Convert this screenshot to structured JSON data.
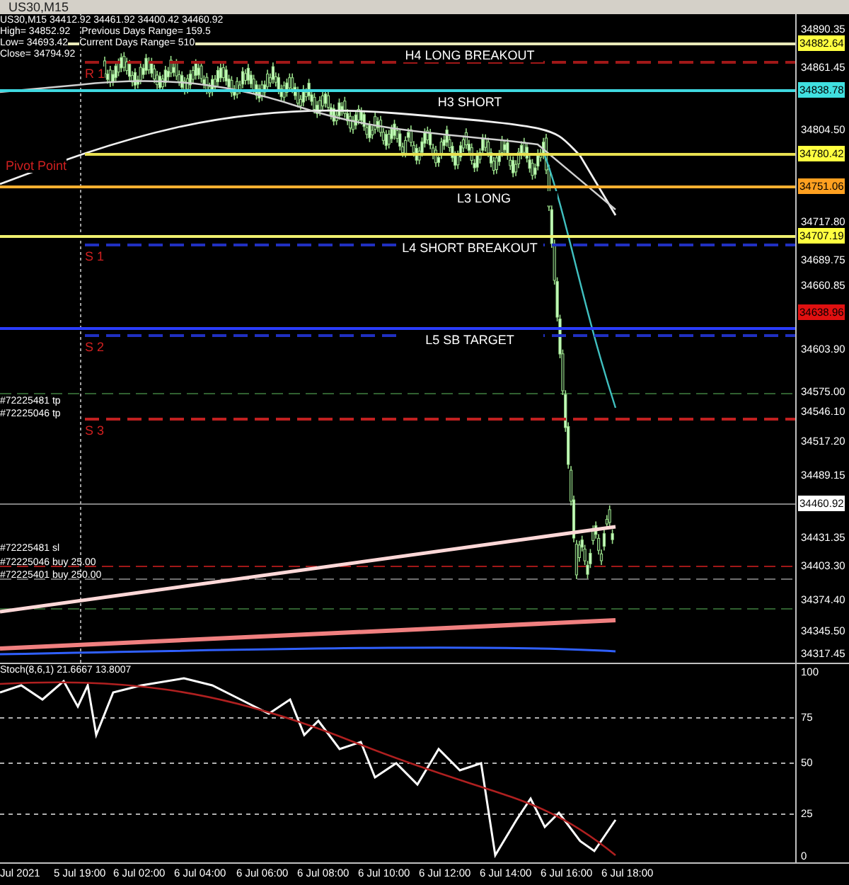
{
  "window": {
    "title": "US30,M15"
  },
  "chart": {
    "info_lines": [
      [
        "US30,M15  34412.92 34461.92 34400.42 34460.92"
      ],
      [
        "High= 34852.92",
        "Previous Days Range= 159.5"
      ],
      [
        "Low= 34693.42",
        "Current Days Range= 510"
      ],
      [
        "Close= 34794.92"
      ]
    ],
    "levels": [
      {
        "label": "H4 LONG BREAKOUT",
        "color": "#e8e8b8"
      },
      {
        "label": "H3 SHORT",
        "color": "#3fd8e0"
      },
      {
        "label": "L3 LONG",
        "color": "#ffb030"
      },
      {
        "label": "L4 SHORT BREAKOUT",
        "color": "#f0f070"
      },
      {
        "label": "L5 SB TARGET",
        "color": "#2a3cff"
      }
    ],
    "pivots": [
      {
        "label": "R 1",
        "color": "#a01818"
      },
      {
        "label": "Pivot Point",
        "color": "#e8e050"
      },
      {
        "label": "S 1",
        "color": "#2030c0"
      },
      {
        "label": "S 2",
        "color": "#2030c0"
      },
      {
        "label": "S 3",
        "color": "#c02020"
      }
    ],
    "orders": [
      "#72225481 tp",
      "#72225046 tp",
      "#72225481 sl",
      "#72225046 buy 25.00",
      "#72225401 buy 250.00"
    ],
    "price_axis": [
      {
        "text": "34890.35"
      },
      {
        "text": "34882.64",
        "color": "#ffff40"
      },
      {
        "text": "34861.45"
      },
      {
        "text": "34838.78",
        "color": "#40e0e0"
      },
      {
        "text": "34804.50"
      },
      {
        "text": "34780.42",
        "color": "#ffff40"
      },
      {
        "text": "34751.06",
        "color": "#ffa020"
      },
      {
        "text": "34717.80"
      },
      {
        "text": "34707.19",
        "color": "#ffff40"
      },
      {
        "text": "34689.75"
      },
      {
        "text": "34660.85"
      },
      {
        "text": "34638.96",
        "color": "#e01010"
      },
      {
        "text": "34603.90"
      },
      {
        "text": "34575.00"
      },
      {
        "text": "34546.10"
      },
      {
        "text": "34517.20"
      },
      {
        "text": "34489.15"
      },
      {
        "text": "34460.92",
        "color": "#ffffff"
      },
      {
        "text": "34431.35"
      },
      {
        "text": "34403.30"
      },
      {
        "text": "34374.40"
      },
      {
        "text": "34345.50"
      },
      {
        "text": "34317.45"
      }
    ]
  },
  "oscillator": {
    "label": "Stoch(8,6,1) 21.6667 13.8007",
    "axis": [
      "100",
      "75",
      "50",
      "25",
      "0"
    ]
  },
  "time_axis": [
    "Jul 2021",
    "5 Jul 19:00",
    "6 Jul 02:00",
    "6 Jul 04:00",
    "6 Jul 06:00",
    "6 Jul 08:00",
    "6 Jul 10:00",
    "6 Jul 12:00",
    "6 Jul 14:00",
    "6 Jul 16:00",
    "6 Jul 18:00"
  ]
}
